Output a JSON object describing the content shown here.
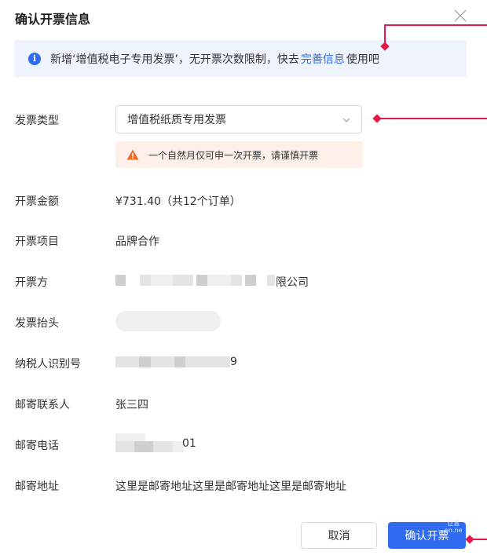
{
  "dialog": {
    "title": "确认开票信息"
  },
  "notice": {
    "prefix": "新增‘增值税电子专用发票’，无开票次数限制，快去",
    "link": "完善信息",
    "suffix": "使用吧"
  },
  "form": {
    "invoice_type": {
      "label": "发票类型",
      "selected": "增值税纸质专用发票"
    },
    "warning": "一个自然月仅可申一次开票，请谨慎开票",
    "amount": {
      "label": "开票金额",
      "value": "¥731.40（共12个订单）"
    },
    "item": {
      "label": "开票项目",
      "value": "品牌合作"
    },
    "issuer": {
      "label": "开票方",
      "value_suffix": "限公司"
    },
    "header": {
      "label": "发票抬头"
    },
    "tax_id": {
      "label": "纳税人识别号",
      "value_suffix": "9"
    },
    "contact": {
      "label": "邮寄联系人",
      "value": "张三四"
    },
    "phone": {
      "label": "邮寄电话",
      "value_suffix": "01"
    },
    "address": {
      "label": "邮寄地址",
      "value": "这里是邮寄地址这里是邮寄地址这里是邮寄地址"
    }
  },
  "buttons": {
    "cancel": "取消",
    "confirm": "确认开票"
  },
  "watermark": {
    "line1": "巨置",
    "line2": "on.ne"
  },
  "colors": {
    "primary": "#2f6bf0",
    "annotation": "#e8174a",
    "notice_bg": "#eef3fe",
    "warning_bg": "#fdf0e9",
    "warning_icon": "#f06a26"
  },
  "icons": {
    "close": "close-icon",
    "info": "info-icon",
    "chevron": "chevron-down-icon",
    "warning": "warning-triangle-icon"
  }
}
